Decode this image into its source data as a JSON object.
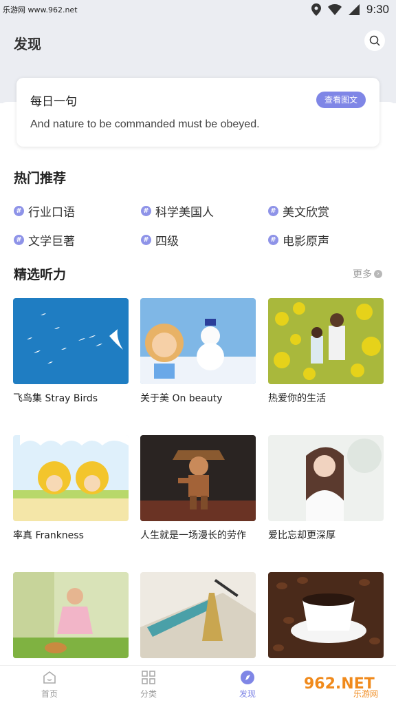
{
  "status_bar": {
    "site_text": "乐游网 www.962.net",
    "time": "9:30"
  },
  "header": {
    "title": "发现"
  },
  "daily": {
    "title": "每日一句",
    "button_label": "查看图文",
    "quote": "And nature to be commanded must be obeyed."
  },
  "hot": {
    "title": "热门推荐",
    "hash_symbol": "#",
    "tags": [
      "行业口语",
      "科学美国人",
      "美文欣赏",
      "文学巨著",
      "四级",
      "电影原声"
    ]
  },
  "featured": {
    "title": "精选听力",
    "more_label": "更多",
    "items": [
      {
        "label": "飞鸟集 Stray Birds"
      },
      {
        "label": "关于美 On beauty"
      },
      {
        "label": "热爱你的生活"
      },
      {
        "label": "率真 Frankness"
      },
      {
        "label": "人生就是一场漫长的劳作"
      },
      {
        "label": "爱比忘却更深厚"
      },
      {
        "label": ""
      },
      {
        "label": ""
      },
      {
        "label": ""
      }
    ]
  },
  "tabbar": {
    "tabs": [
      {
        "label": "首页",
        "icon": "home-icon"
      },
      {
        "label": "分类",
        "icon": "grid-icon"
      },
      {
        "label": "发现",
        "icon": "compass-icon"
      }
    ]
  },
  "watermark": {
    "text": "962.NET",
    "sub": "乐游网"
  },
  "colors": {
    "accent": "#7f86e6",
    "header_bg": "#ebedf2"
  }
}
